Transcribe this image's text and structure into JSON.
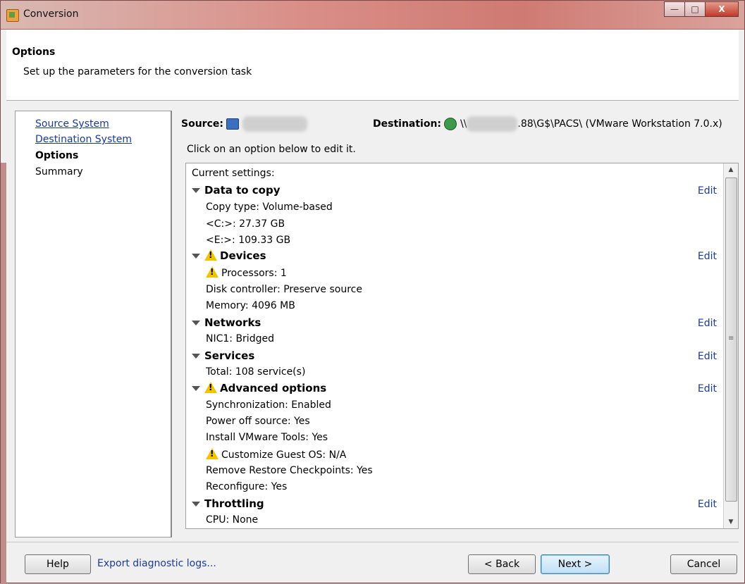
{
  "window": {
    "title": "Conversion",
    "controls": {
      "minimize": "—",
      "maximize": "□",
      "close": "X"
    }
  },
  "header": {
    "title": "Options",
    "subtitle": "Set up the parameters for the conversion task"
  },
  "nav": {
    "items": [
      {
        "label": "Source System",
        "state": "link"
      },
      {
        "label": "Destination System",
        "state": "link"
      },
      {
        "label": "Options",
        "state": "current"
      },
      {
        "label": "Summary",
        "state": "plain"
      }
    ]
  },
  "source": {
    "label": "Source:",
    "icon": "computer-icon"
  },
  "destination": {
    "label": "Destination:",
    "icon": "vmware-icon",
    "path_prefix": "\\\\",
    "path_suffix": ".88\\G$\\PACS\\ (VMware Workstation 7.0.x)"
  },
  "hint": "Click on an option below to edit it.",
  "settings": {
    "header": "Current settings:",
    "edit_label": "Edit",
    "sections": [
      {
        "title": "Data to copy",
        "warn": false,
        "items": [
          {
            "text": "Copy type: Volume-based",
            "warn": false
          },
          {
            "text": "<C:>: 27.37 GB",
            "warn": false
          },
          {
            "text": "<E:>: 109.33 GB",
            "warn": false
          }
        ]
      },
      {
        "title": "Devices",
        "warn": true,
        "items": [
          {
            "text": "Processors: 1",
            "warn": true
          },
          {
            "text": "Disk controller: Preserve source",
            "warn": false
          },
          {
            "text": "Memory: 4096 MB",
            "warn": false
          }
        ]
      },
      {
        "title": "Networks",
        "warn": false,
        "items": [
          {
            "text": "NIC1: Bridged",
            "warn": false
          }
        ]
      },
      {
        "title": "Services",
        "warn": false,
        "items": [
          {
            "text": "Total: 108 service(s)",
            "warn": false
          }
        ]
      },
      {
        "title": "Advanced options",
        "warn": true,
        "items": [
          {
            "text": "Synchronization: Enabled",
            "warn": false
          },
          {
            "text": "Power off source: Yes",
            "warn": false
          },
          {
            "text": "Install VMware Tools: Yes",
            "warn": false
          },
          {
            "text": "Customize Guest OS: N/A",
            "warn": true
          },
          {
            "text": "Remove Restore Checkpoints: Yes",
            "warn": false
          },
          {
            "text": "Reconfigure: Yes",
            "warn": false
          }
        ]
      },
      {
        "title": "Throttling",
        "warn": false,
        "items": [
          {
            "text": "CPU: None",
            "warn": false
          }
        ]
      }
    ]
  },
  "footer": {
    "help": "Help",
    "export_logs": "Export diagnostic logs...",
    "back": "< Back",
    "next": "Next >",
    "cancel": "Cancel"
  },
  "colors": {
    "link": "#1a3a9e",
    "warning": "#f2c300",
    "titlebar": "#d98f88"
  }
}
